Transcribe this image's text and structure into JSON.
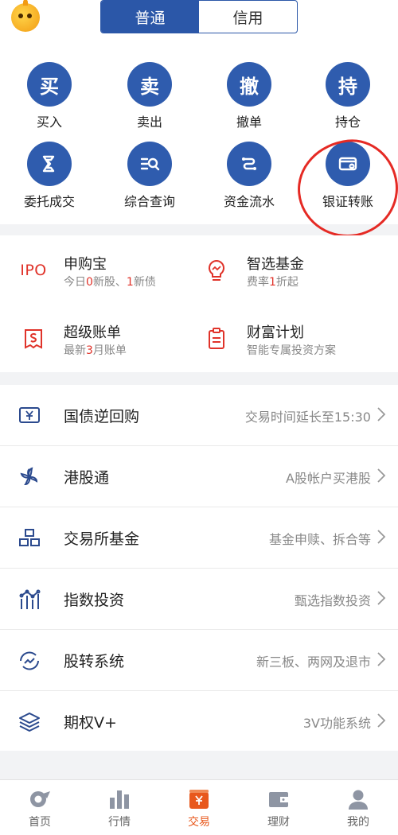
{
  "header": {
    "segments": [
      {
        "label": "普通",
        "active": true
      },
      {
        "label": "信用",
        "active": false
      }
    ]
  },
  "actions": [
    {
      "glyph": "买",
      "label": "买入"
    },
    {
      "glyph": "卖",
      "label": "卖出"
    },
    {
      "glyph": "撤",
      "label": "撤单"
    },
    {
      "glyph": "持",
      "label": "持仓"
    },
    {
      "icon": "order-deal-icon",
      "label": "委托成交"
    },
    {
      "icon": "query-icon",
      "label": "综合查询"
    },
    {
      "icon": "fund-flow-icon",
      "label": "资金流水"
    },
    {
      "icon": "bank-card-transfer-icon",
      "label": "银证转账"
    }
  ],
  "services": [
    {
      "icon_text": "IPO",
      "title": "申购宝",
      "sub_pre": "今日",
      "sub_n1": "0",
      "sub_mid": "新股、",
      "sub_n2": "1",
      "sub_post": "新债"
    },
    {
      "icon": "lightbulb-chart-icon",
      "title": "智选基金",
      "sub_pre": "费率",
      "sub_n1": "1",
      "sub_mid": "折起"
    },
    {
      "icon": "bill-icon",
      "title": "超级账单",
      "sub_pre": "最新",
      "sub_n1": "3",
      "sub_mid": "月账单"
    },
    {
      "icon": "clipboard-icon",
      "title": "财富计划",
      "sub_pre": "智能专属投资方案"
    }
  ],
  "list": [
    {
      "icon": "yuan-screen-icon",
      "title": "国债逆回购",
      "hint": "交易时间延长至15:30"
    },
    {
      "icon": "bauhinia-icon",
      "title": "港股通",
      "hint": "A股帐户买港股"
    },
    {
      "icon": "pyramid-boxes-icon",
      "title": "交易所基金",
      "hint": "基金申赎、拆合等"
    },
    {
      "icon": "index-chart-icon",
      "title": "指数投资",
      "hint": "甄选指数投资"
    },
    {
      "icon": "cycle-trend-icon",
      "title": "股转系统",
      "hint": "新三板、两网及退市"
    },
    {
      "icon": "layers-icon",
      "title": "期权V+",
      "hint": "3V功能系统"
    }
  ],
  "nav": [
    {
      "icon": "home-icon",
      "label": "首页",
      "active": false
    },
    {
      "icon": "market-bars-icon",
      "label": "行情",
      "active": false
    },
    {
      "icon": "trade-yuan-icon",
      "label": "交易",
      "active": true
    },
    {
      "icon": "wallet-icon",
      "label": "理财",
      "active": false
    },
    {
      "icon": "person-icon",
      "label": "我的",
      "active": false
    }
  ],
  "colors": {
    "brand_blue": "#2f5cae",
    "accent_orange": "#e8581c",
    "annotation_red": "#e52a24",
    "highlight_red": "#e0332a"
  }
}
